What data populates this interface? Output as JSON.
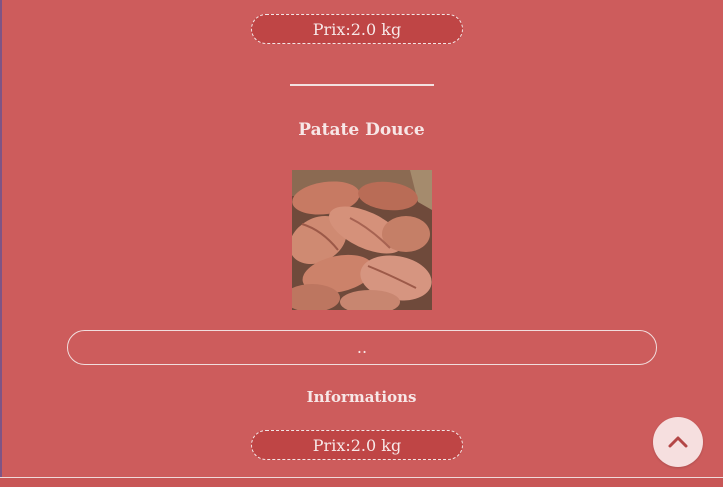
{
  "product": {
    "price_top": "Prix:2.0 kg",
    "name": "Patate Douce",
    "description": "..",
    "info_title": "Informations",
    "price_bottom": "Prix:2.0 kg",
    "image_icon": "sweet-potato-photo"
  },
  "ui": {
    "scroll_top_icon": "chevron-up-icon"
  },
  "colors": {
    "background": "#cd5c5c",
    "pill": "#bf4545",
    "text": "#f7e8e8",
    "scroll_button": "#f6dfdf"
  }
}
